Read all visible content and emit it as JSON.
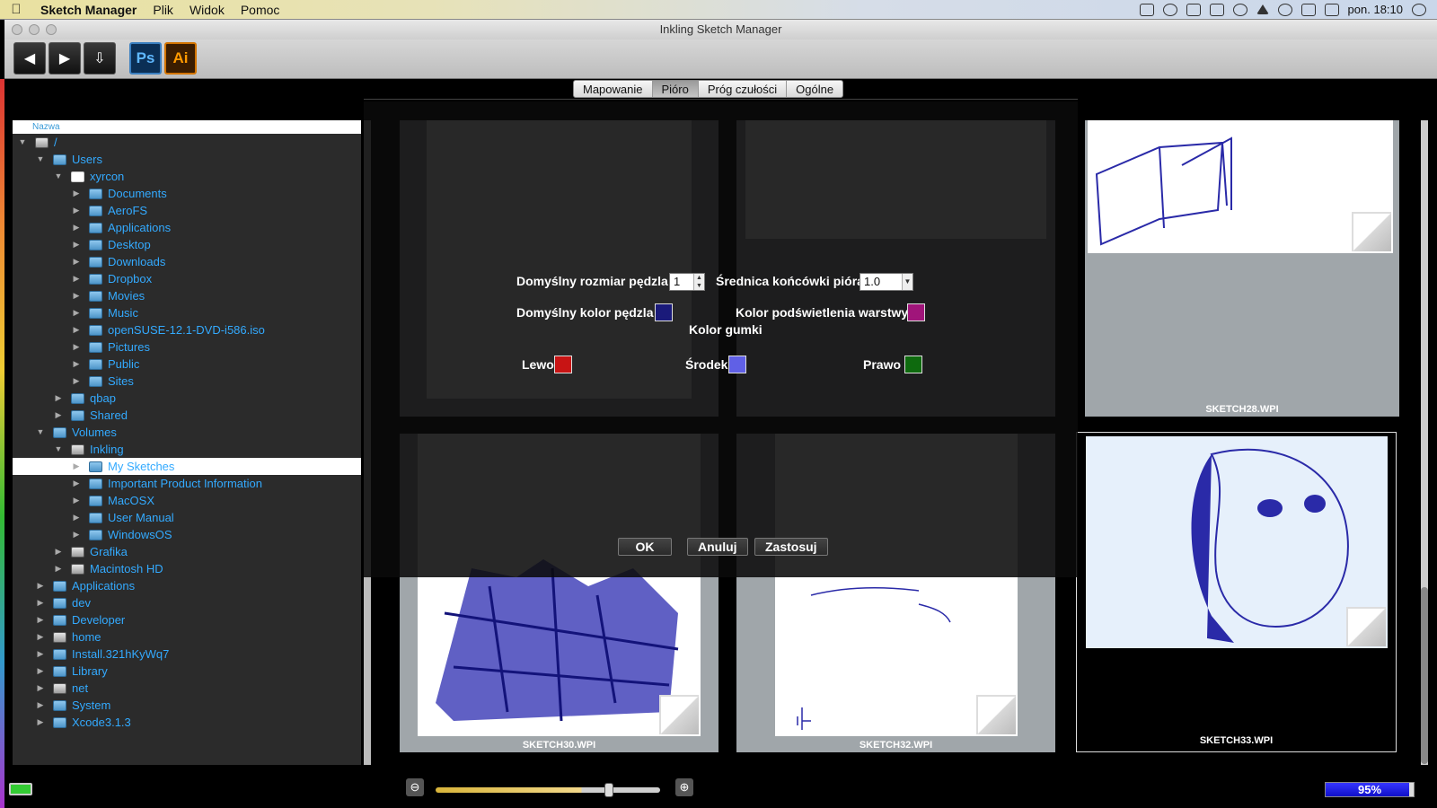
{
  "menubar": {
    "app": "Sketch Manager",
    "items": [
      "Plik",
      "Widok",
      "Pomoc"
    ],
    "clock": "pon. 18:10"
  },
  "window": {
    "title": "Inkling Sketch Manager"
  },
  "toolbar": {
    "ps_label": "Ps",
    "ai_label": "Ai"
  },
  "tabs": [
    "Mapowanie",
    "Pióro",
    "Próg czułości",
    "Ogólne"
  ],
  "tree": {
    "header": "Nazwa",
    "rows": [
      {
        "label": "/",
        "icon": "drive-icon"
      },
      {
        "label": "Users",
        "icon": "folder-icon"
      },
      {
        "label": "xyrcon",
        "icon": "home-icon"
      },
      {
        "label": "Documents",
        "icon": "folder-icon"
      },
      {
        "label": "AeroFS",
        "icon": "folder-icon"
      },
      {
        "label": "Applications",
        "icon": "folder-icon"
      },
      {
        "label": "Desktop",
        "icon": "folder-icon"
      },
      {
        "label": "Downloads",
        "icon": "folder-icon"
      },
      {
        "label": "Dropbox",
        "icon": "folder-icon"
      },
      {
        "label": "Movies",
        "icon": "folder-icon"
      },
      {
        "label": "Music",
        "icon": "folder-icon"
      },
      {
        "label": "openSUSE-12.1-DVD-i586.iso",
        "icon": "folder-icon"
      },
      {
        "label": "Pictures",
        "icon": "folder-icon"
      },
      {
        "label": "Public",
        "icon": "folder-icon"
      },
      {
        "label": "Sites",
        "icon": "folder-icon"
      },
      {
        "label": "qbap",
        "icon": "folder-icon"
      },
      {
        "label": "Shared",
        "icon": "folder-icon"
      },
      {
        "label": "Volumes",
        "icon": "folder-icon"
      },
      {
        "label": "Inkling",
        "icon": "drive-icon"
      },
      {
        "label": "My Sketches",
        "icon": "folder-icon"
      },
      {
        "label": "Important Product Information",
        "icon": "folder-icon"
      },
      {
        "label": "MacOSX",
        "icon": "folder-icon"
      },
      {
        "label": "User Manual",
        "icon": "folder-icon"
      },
      {
        "label": "WindowsOS",
        "icon": "folder-icon"
      },
      {
        "label": "Grafika",
        "icon": "drive-icon"
      },
      {
        "label": "Macintosh HD",
        "icon": "drive-icon"
      },
      {
        "label": "Applications",
        "icon": "folder-icon"
      },
      {
        "label": "dev",
        "icon": "folder-icon"
      },
      {
        "label": "Developer",
        "icon": "folder-icon"
      },
      {
        "label": "home",
        "icon": "drive-icon"
      },
      {
        "label": "Install.321hKyWq7",
        "icon": "folder-icon"
      },
      {
        "label": "Library",
        "icon": "folder-icon"
      },
      {
        "label": "net",
        "icon": "drive-icon"
      },
      {
        "label": "System",
        "icon": "folder-icon"
      },
      {
        "label": "Xcode3.1.3",
        "icon": "folder-icon"
      }
    ]
  },
  "thumbnails": {
    "sketch28": "SKETCH28.WPI",
    "sketch30": "SKETCH30.WPI",
    "sketch32": "SKETCH32.WPI",
    "sketch33": "SKETCH33.WPI"
  },
  "dialog": {
    "brush_size_label": "Domyślny rozmiar pędzla",
    "brush_size_value": "1",
    "tip_diameter_label": "Średnica końcówki pióra",
    "tip_diameter_value": "1.0",
    "brush_color_label": "Domyślny kolor pędzla",
    "brush_color": "#1a1a7a",
    "layer_highlight_label": "Kolor podświetlenia warstwy",
    "layer_highlight_color": "#a0157a",
    "eraser_color_label": "Kolor gumki",
    "left_label": "Lewo",
    "left_color": "#c81414",
    "middle_label": "Środek",
    "middle_color": "#6060e6",
    "right_label": "Prawo",
    "right_color": "#0e6a0e",
    "ok": "OK",
    "cancel": "Anuluj",
    "apply": "Zastosuj"
  },
  "statusbar": {
    "progress": 0.95,
    "progress_label": "95%"
  }
}
